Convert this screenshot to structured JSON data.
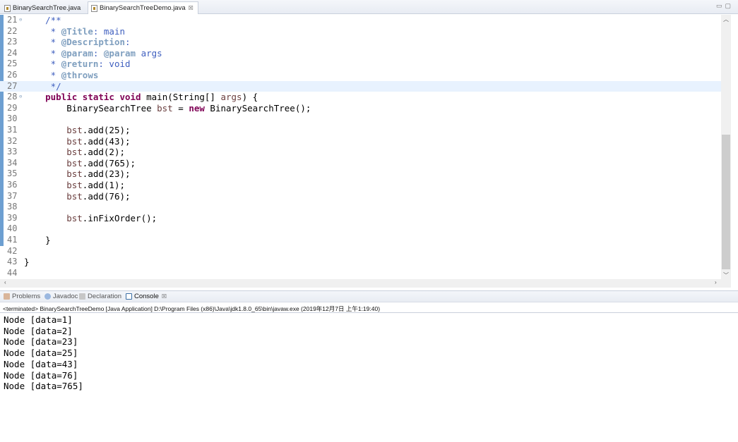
{
  "editor_tabs": [
    {
      "label": "BinarySearchTree.java",
      "active": false
    },
    {
      "label": "BinarySearchTreeDemo.java",
      "active": true,
      "close": "☒"
    }
  ],
  "editor": {
    "lines": [
      {
        "num": "21",
        "text": "    /**"
      },
      {
        "num": "22",
        "text": "     * @Title: main"
      },
      {
        "num": "23",
        "text": "     * @Description:"
      },
      {
        "num": "24",
        "text": "     * @param: @param args"
      },
      {
        "num": "25",
        "text": "     * @return: void"
      },
      {
        "num": "26",
        "text": "     * @throws"
      },
      {
        "num": "27",
        "text": "     */"
      },
      {
        "num": "28",
        "text": "    public static void main(String[] args) {"
      },
      {
        "num": "29",
        "text": "        BinarySearchTree bst = new BinarySearchTree();"
      },
      {
        "num": "30",
        "text": ""
      },
      {
        "num": "31",
        "text": "        bst.add(25);"
      },
      {
        "num": "32",
        "text": "        bst.add(43);"
      },
      {
        "num": "33",
        "text": "        bst.add(2);"
      },
      {
        "num": "34",
        "text": "        bst.add(765);"
      },
      {
        "num": "35",
        "text": "        bst.add(23);"
      },
      {
        "num": "36",
        "text": "        bst.add(1);"
      },
      {
        "num": "37",
        "text": "        bst.add(76);"
      },
      {
        "num": "38",
        "text": ""
      },
      {
        "num": "39",
        "text": "        bst.inFixOrder();"
      },
      {
        "num": "40",
        "text": ""
      },
      {
        "num": "41",
        "text": "    }"
      },
      {
        "num": "42",
        "text": ""
      },
      {
        "num": "43",
        "text": "}"
      },
      {
        "num": "44",
        "text": ""
      }
    ]
  },
  "panel_tabs": [
    {
      "label": "Problems",
      "icon": "problems-icon",
      "active": false
    },
    {
      "label": "Javadoc",
      "icon": "javadoc-icon",
      "active": false
    },
    {
      "label": "Declaration",
      "icon": "declaration-icon",
      "active": false
    },
    {
      "label": "Console",
      "icon": "console-icon",
      "active": true,
      "close": "☒"
    }
  ],
  "console": {
    "status": "<terminated> BinarySearchTreeDemo [Java Application] D:\\Program Files (x86)\\Java\\jdk1.8.0_65\\bin\\javaw.exe (2019年12月7日 上午1:19:40)",
    "output": [
      "Node [data=1]",
      "Node [data=2]",
      "Node [data=23]",
      "Node [data=25]",
      "Node [data=43]",
      "Node [data=76]",
      "Node [data=765]"
    ]
  },
  "colors": {
    "keyword": "#7f0055",
    "javadoc": "#3f5fbf",
    "javadoc_tag": "#7f9fbf",
    "current_line": "#e8f2fe",
    "ruler": "#6d9fd1"
  }
}
